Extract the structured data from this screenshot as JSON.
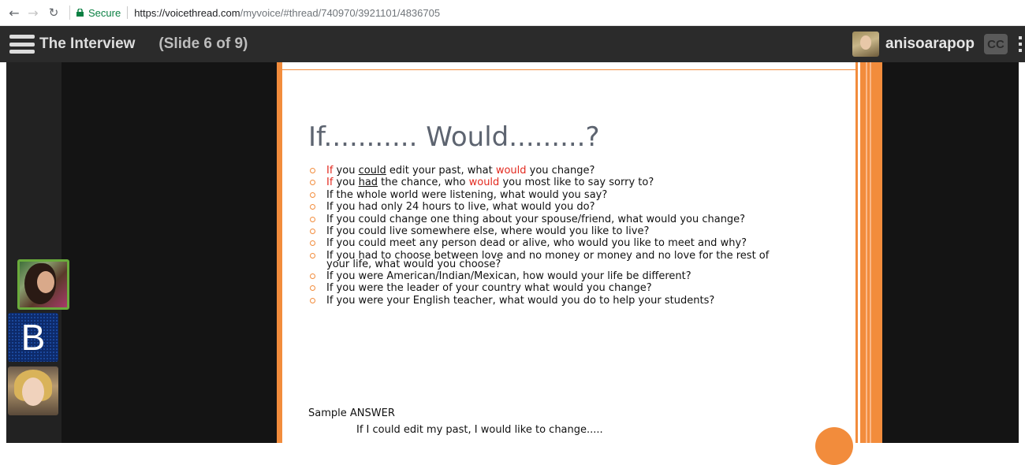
{
  "browser": {
    "secure_label": "Secure",
    "url_host": "https://voicethread.com",
    "url_path": "/myvoice/#thread/740970/3921101/4836705"
  },
  "header": {
    "title": "The Interview",
    "slide_info": "(Slide 6 of 9)",
    "username": "anisoarapop",
    "cc_label": "CC"
  },
  "sidebar": {
    "avatars": [
      {
        "name": "user-photo-1"
      },
      {
        "name": "user-initial-b",
        "initial": "B"
      },
      {
        "name": "user-photo-3"
      }
    ]
  },
  "slide": {
    "heading": "If........... Would.........?",
    "questions": [
      {
        "parts": [
          "If",
          " you ",
          "could",
          " edit your past, what ",
          "would",
          " you change?"
        ]
      },
      {
        "parts": [
          "If",
          " you ",
          "had",
          " the chance, who ",
          "would",
          " you most like to say sorry to?"
        ]
      },
      {
        "text": "If the whole world were listening, what would you say?"
      },
      {
        "text": "If you had only 24 hours to live, what would you do?"
      },
      {
        "text": "If you could change one thing about your spouse/friend, what would you change?"
      },
      {
        "text": "If you could live somewhere else, where would you like to live?"
      },
      {
        "text": "If you could meet any person dead or alive, who would you like to meet and why?"
      },
      {
        "line1": "If you had to choose between love and no money or money and no love for the rest of",
        "line2": "your life, what would you choose?"
      },
      {
        "text": "If you were American/Indian/Mexican, how would your life be different?"
      },
      {
        "text": "If you were the leader of your country what would you change?"
      },
      {
        "text": "If you were your English teacher, what would you do to help your students?"
      }
    ],
    "sample_label": "Sample ANSWER",
    "sample_answer": "If I could edit my past, I would like to change....."
  },
  "colors": {
    "accent_orange": "#f28c3c",
    "highlight_red": "#e32a1f",
    "header_bg": "#2b2b2b",
    "secure_green": "#0b8043"
  },
  "icons": {
    "back": "back-arrow-icon",
    "forward": "forward-arrow-icon",
    "reload": "reload-icon",
    "lock": "lock-icon",
    "menu": "hamburger-menu-icon",
    "more": "more-vertical-icon"
  }
}
